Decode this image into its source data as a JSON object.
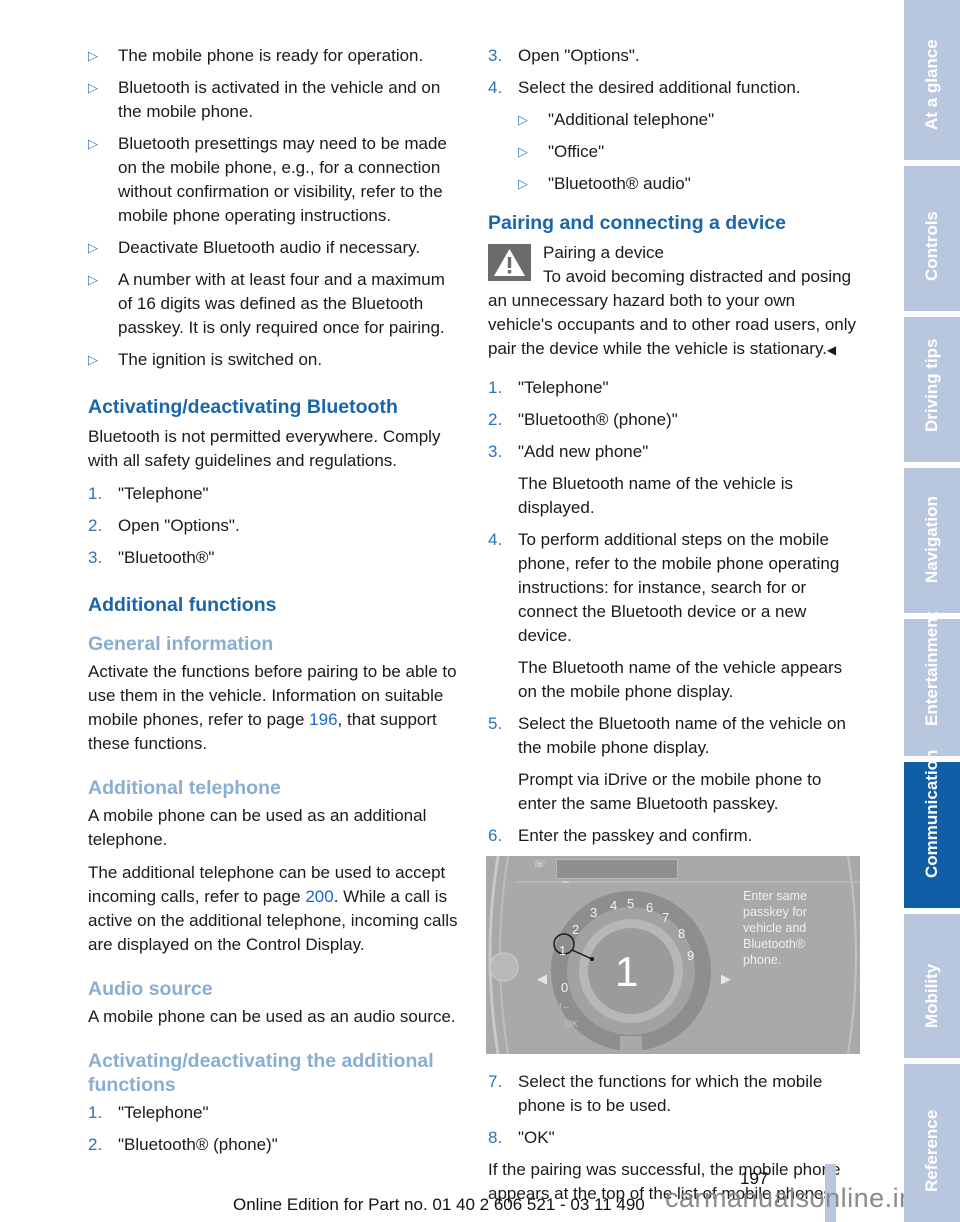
{
  "left_column": {
    "requirements": [
      "The mobile phone is ready for operation.",
      "Bluetooth is activated in the vehicle and on the mobile phone.",
      "Bluetooth presettings may need to be made on the mobile phone, e.g., for a connection without confirmation or visibility, refer to the mobile phone operating instructions.",
      "Deactivate Bluetooth audio if necessary.",
      "A number with at least four and a maximum of 16 digits was defined as the Bluetooth passkey. It is only required once for pairing.",
      "The ignition is switched on."
    ],
    "activating": {
      "heading": "Activating/deactivating Bluetooth",
      "text": "Bluetooth is not permitted everywhere. Comply with all safety guidelines and regulations.",
      "steps": [
        {
          "num": "1.",
          "text": "\"Telephone\""
        },
        {
          "num": "2.",
          "text": "Open \"Options\"."
        },
        {
          "num": "3.",
          "text": "\"Bluetooth®\""
        }
      ]
    },
    "additional_functions": {
      "heading": "Additional functions",
      "general": {
        "heading": "General information",
        "text_before": "Activate the functions before pairing to be able to use them in the vehicle. Information on suitable mobile phones, refer to page ",
        "link": "196",
        "text_after": ", that support these functions."
      },
      "additional_telephone": {
        "heading": "Additional telephone",
        "text1": "A mobile phone can be used as an additional telephone.",
        "text2_before": "The additional telephone can be used to accept incoming calls, refer to page ",
        "link": "200",
        "text2_after": ". While a call is active on the additional telephone, incoming calls are displayed on the Control Display."
      },
      "audio_source": {
        "heading": "Audio source",
        "text": "A mobile phone can be used as an audio source."
      },
      "activating_additional": {
        "heading": "Activating/deactivating the additional functions",
        "steps": [
          {
            "num": "1.",
            "text": "\"Telephone\""
          },
          {
            "num": "2.",
            "text": "\"Bluetooth® (phone)\""
          }
        ]
      }
    }
  },
  "right_column": {
    "continued_steps": [
      {
        "num": "3.",
        "text": "Open \"Options\"."
      },
      {
        "num": "4.",
        "text": "Select the desired additional function.",
        "sub": [
          "\"Additional telephone\"",
          "\"Office\"",
          "\"Bluetooth® audio\""
        ]
      }
    ],
    "pairing": {
      "heading": "Pairing and connecting a device",
      "warning_title": "Pairing a device",
      "warning_text": "To avoid becoming distracted and posing an unnecessary hazard both to your own vehicle's occupants and to other road users, only pair the device while the vehicle is stationary.",
      "end_mark": "◀",
      "steps": [
        {
          "num": "1.",
          "text": "\"Telephone\""
        },
        {
          "num": "2.",
          "text": "\"Bluetooth® (phone)\""
        },
        {
          "num": "3.",
          "text": "\"Add new phone\"",
          "note": "The Bluetooth name of the vehicle is displayed."
        },
        {
          "num": "4.",
          "text": "To perform additional steps on the mobile phone, refer to the mobile phone operating instructions: for instance, search for or connect the Bluetooth device or a new device.",
          "note": "The Bluetooth name of the vehicle appears on the mobile phone display."
        },
        {
          "num": "5.",
          "text": "Select the Bluetooth name of the vehicle on the mobile phone display.",
          "note": "Prompt via iDrive or the mobile phone to enter the same Bluetooth passkey."
        },
        {
          "num": "6.",
          "text": "Enter the passkey and confirm."
        }
      ],
      "figure": {
        "input_value": "_",
        "digits": [
          "0",
          "1",
          "2",
          "3",
          "4",
          "5",
          "6",
          "7",
          "8",
          "9"
        ],
        "selected_digit": "1",
        "callout": "1",
        "back_label": "I←",
        "ok_label": "OK",
        "message_lines": [
          "Enter same",
          "passkey for",
          "vehicle and",
          "Bluetooth®",
          "phone."
        ]
      },
      "steps_after": [
        {
          "num": "7.",
          "text": "Select the functions for which the mobile phone is to be used."
        },
        {
          "num": "8.",
          "text": "\"OK\""
        }
      ],
      "conclusion": "If the pairing was successful, the mobile phone appears at the top of the list of mobile phones."
    }
  },
  "footer": {
    "page_number": "197",
    "edition": "Online Edition for Part no. 01 40 2 606 521 - 03 11 490",
    "watermark": "carmanualsonline.info"
  },
  "side_tabs": [
    {
      "label": "At a glance",
      "active": false
    },
    {
      "label": "Controls",
      "active": false
    },
    {
      "label": "Driving tips",
      "active": false
    },
    {
      "label": "Navigation",
      "active": false
    },
    {
      "label": "Entertainment",
      "active": false
    },
    {
      "label": "Communication",
      "active": true
    },
    {
      "label": "Mobility",
      "active": false
    },
    {
      "label": "Reference",
      "active": false
    }
  ],
  "colors": {
    "heading_primary": "#1b66a8",
    "heading_secondary": "#8aaed3",
    "link": "#1a66d6",
    "tab_inactive": "#b9c7de",
    "tab_active": "#0f5ea6"
  }
}
